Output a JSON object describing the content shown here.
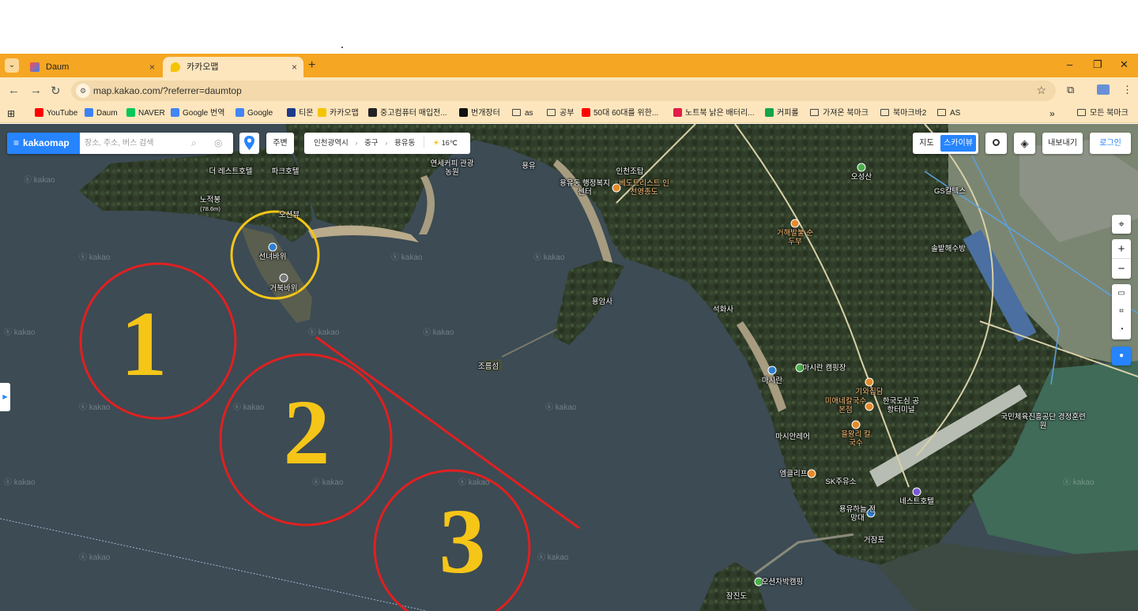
{
  "browser": {
    "tabs": [
      {
        "label": "Daum",
        "close": "×"
      },
      {
        "label": "카카오맵",
        "close": "×"
      }
    ],
    "new_tab": "+",
    "tab_menu": "⌄",
    "window_controls": [
      "–",
      "❐",
      "✕"
    ],
    "nav": {
      "back": "←",
      "forward": "→",
      "reload": "↻"
    },
    "url": "map.kakao.com/?referrer=daumtop",
    "star": "☆",
    "bookmarks": [
      {
        "label": "YouTube",
        "color": "#ff0000"
      },
      {
        "label": "Daum",
        "color": "#3b82f6"
      },
      {
        "label": "NAVER",
        "color": "#03c75a"
      },
      {
        "label": "Google 번역",
        "color": "#4285f4"
      },
      {
        "label": "Google",
        "color": "#4285f4"
      },
      {
        "label": "티몬",
        "color": "#1e3a8a"
      },
      {
        "label": "카카오맵",
        "color": "#f5c400"
      },
      {
        "label": "중고컴퓨터 매입전...",
        "color": "#222222"
      },
      {
        "label": "번개장터",
        "color": "#111111"
      },
      {
        "label": "as",
        "folder": true
      },
      {
        "label": "공부",
        "folder": true
      },
      {
        "label": "50대 60대를 위한...",
        "color": "#ff0000"
      },
      {
        "label": "노트북 낡은 배터리...",
        "color": "#e11d48"
      },
      {
        "label": "커피롤",
        "color": "#16a34a"
      },
      {
        "label": "가져온 북마크",
        "folder": true
      },
      {
        "label": "북마크바2",
        "folder": true
      },
      {
        "label": "AS",
        "folder": true
      }
    ],
    "more": "»",
    "all_bookmarks": "모든 북마크"
  },
  "kakaomap": {
    "brand": "kakaomap",
    "menu_icon": "≡",
    "search_placeholder": "장소, 주소, 버스 검색",
    "nearby": "주변",
    "breadcrumb": [
      "인천광역시",
      "중구",
      "용유동"
    ],
    "weather": "16℃",
    "view_map": "지도",
    "view_sky": "스카이뷰",
    "export": "내보내기",
    "login": "로그인",
    "zoom_in": "+",
    "zoom_out": "−",
    "watermark": "ⓚ kakao"
  },
  "map_labels": {
    "hotel1": "더 레스트호텔",
    "hotel2": "파크호텔",
    "peak": "노적봉",
    "peak_height": "(78.6m)",
    "oceanview": "오션뷰",
    "seonnyeo": "선녀바위",
    "geobuk": "거북바위",
    "yonsei": "연세커피 관광농원",
    "yongyu": "용유",
    "welfare": "용유동 행정복지센터",
    "incheon_post": "인천조탑",
    "incheon_beach": "베도트리스트 인천영종도",
    "oseongsan": "오성산",
    "gs": "GS칼텍스",
    "paldo": "거해발불 순두부",
    "solbat": "솔밭해수방",
    "yongam": "용암사",
    "seokhwa": "석화사",
    "joreum": "조름섬",
    "masi_camp": "마시란 캠핑장",
    "masi": "마시란",
    "giwa": "기와집담",
    "minae": "미애네칼국수 본점",
    "tourism": "한국도심 공항터미널",
    "training": "국민체육진흥공단 경정훈련원",
    "masian": "마시안레어",
    "kalguksu": "을왕리 칼국수",
    "embrick": "엠클리프",
    "sk": "SK주유소",
    "yongyuha": "용유하늘 전망대",
    "dest": "네스트호텔",
    "geojeongpo": "거잠포",
    "ocean_camp": "오션차박캠핑",
    "jamjin": "잠진도"
  },
  "annotations": {
    "zones": [
      "1",
      "2",
      "3"
    ],
    "zone_color": "#e02020",
    "number_color": "#f5c518",
    "highlight_color": "#f5c518"
  }
}
